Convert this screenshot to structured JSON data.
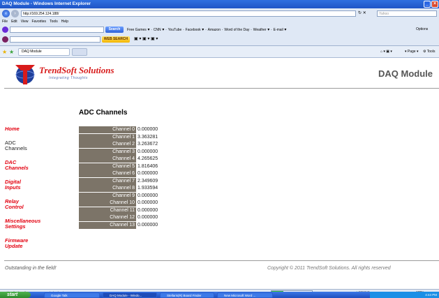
{
  "window": {
    "title": "DAQ Module - Windows Internet Explorer"
  },
  "address": {
    "url": "http://169.254.124.188/",
    "search_placeholder": "Yahoo"
  },
  "menu": [
    "File",
    "Edit",
    "View",
    "Favorites",
    "Tools",
    "Help"
  ],
  "toolbar1": {
    "search_button": "Search",
    "links": [
      "Free Games",
      "CNN",
      "YouTube",
      "Facebook",
      "Amazon",
      "Word of the Day",
      "Weather",
      "E-mail"
    ],
    "options": "Options"
  },
  "toolbar2": {
    "web_search": "WEB SEARCH"
  },
  "tab": {
    "label": "DAQ Module"
  },
  "cmdbar": {
    "page": "Page",
    "tools": "Tools"
  },
  "page": {
    "brand": "TrendSoft Solutions",
    "tagline": "Integrating Thoughts",
    "module_title": "DAQ Module",
    "heading": "ADC Channels",
    "nav": [
      {
        "label": "Home",
        "active": false
      },
      {
        "label": "ADC Channels",
        "active": true
      },
      {
        "label": "DAC Channels",
        "active": false
      },
      {
        "label": "Digital Inputs",
        "active": false
      },
      {
        "label": "Relay Control",
        "active": false
      },
      {
        "label": "Miscellaneous Settings",
        "active": false
      },
      {
        "label": "Firmware Update",
        "active": false
      }
    ],
    "channels": [
      {
        "name": "Channel 0",
        "value": "0.000000"
      },
      {
        "name": "Channel 1",
        "value": "3.363281"
      },
      {
        "name": "Channel 2",
        "value": "3.263672"
      },
      {
        "name": "Channel 3",
        "value": "0.000000"
      },
      {
        "name": "Channel 4",
        "value": "4.265625"
      },
      {
        "name": "Channel 5",
        "value": "1.816406"
      },
      {
        "name": "Channel 6",
        "value": "0.000000"
      },
      {
        "name": "Channel 7",
        "value": "2.349609"
      },
      {
        "name": "Channel 8",
        "value": "1.933594"
      },
      {
        "name": "Channel 9",
        "value": "0.000000"
      },
      {
        "name": "Channel 10",
        "value": "0.000000"
      },
      {
        "name": "Channel 11",
        "value": "0.000000"
      },
      {
        "name": "Channel 12",
        "value": "0.000000"
      },
      {
        "name": "Channel 13",
        "value": "0.000000"
      }
    ],
    "footer_left": "Outstanding in the field!",
    "footer_right": "Copyright © 2011 TrendSoft Solutions. All rights reserved"
  },
  "status": {
    "text": "Waiting for http://169.254.124.188/adc.shtml...",
    "zone": "Internet",
    "zoom": "100%",
    "progress": 0.3
  },
  "taskbar": {
    "start": "start",
    "tasks": [
      "Google Talk",
      "DAQ Module - Windo...",
      "Stellaris(R) Board Finder",
      "New Microsoft Word ..."
    ],
    "clock": "4:44 PM"
  },
  "colors": {
    "accent_red": "#e3000f",
    "channel_bg": "#7c7468",
    "title_blue": "#1f55c7"
  }
}
